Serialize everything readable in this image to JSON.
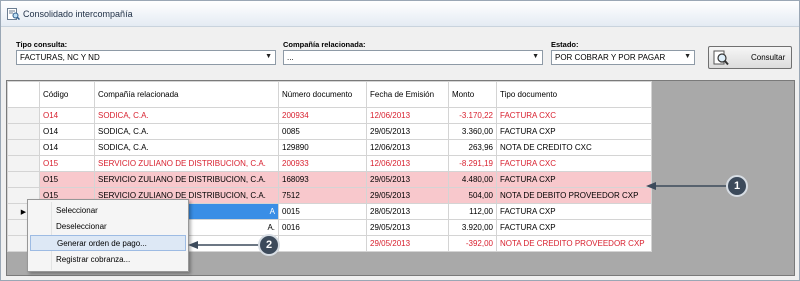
{
  "window": {
    "title": "Consolidado intercompañía"
  },
  "filters": {
    "tipo_label": "Tipo consulta:",
    "tipo_value": "FACTURAS, NC Y ND",
    "compania_label": "Compañía relacionada:",
    "compania_value": "...",
    "estado_label": "Estado:",
    "estado_value": "POR COBRAR Y POR PAGAR",
    "consultar_label": "Consultar"
  },
  "grid": {
    "headers": {
      "codigo": "Código",
      "compania": "Compañía relacionada",
      "numero": "Número documento",
      "fecha": "Fecha de Emisión",
      "monto": "Monto",
      "tipo": "Tipo documento"
    },
    "rows": [
      {
        "codigo": "O14",
        "compania": "SODICA, C.A.",
        "numero": "200934",
        "fecha": "12/06/2013",
        "monto": "-3.170,22",
        "tipo": "FACTURA CXC"
      },
      {
        "codigo": "O14",
        "compania": "SODICA, C.A.",
        "numero": "0085",
        "fecha": "29/05/2013",
        "monto": "3.360,00",
        "tipo": "FACTURA CXP"
      },
      {
        "codigo": "O14",
        "compania": "SODICA, C.A.",
        "numero": "129890",
        "fecha": "12/06/2013",
        "monto": "263,96",
        "tipo": "NOTA DE CREDITO CXC"
      },
      {
        "codigo": "O15",
        "compania": "SERVICIO ZULIANO DE DISTRIBUCION, C.A.",
        "numero": "200933",
        "fecha": "12/06/2013",
        "monto": "-8.291,19",
        "tipo": "FACTURA CXC"
      },
      {
        "codigo": "O15",
        "compania": "SERVICIO ZULIANO DE DISTRIBUCION, C.A.",
        "numero": "168093",
        "fecha": "29/05/2013",
        "monto": "4.480,00",
        "tipo": "FACTURA CXP"
      },
      {
        "codigo": "O15",
        "compania": "SERVICIO ZULIANO DE DISTRIBUCION, C.A.",
        "numero": "7512",
        "fecha": "29/05/2013",
        "monto": "504,00",
        "tipo": "NOTA DE DEBITO PROVEEDOR CXP"
      },
      {
        "codigo": "",
        "compania": "A",
        "numero": "0015",
        "fecha": "28/05/2013",
        "monto": "112,00",
        "tipo": "FACTURA CXP"
      },
      {
        "codigo": "",
        "compania": "A.",
        "numero": "0016",
        "fecha": "29/05/2013",
        "monto": "3.920,00",
        "tipo": "FACTURA CXP"
      },
      {
        "codigo": "",
        "compania": "",
        "numero": "",
        "fecha": "29/05/2013",
        "monto": "-392,00",
        "tipo": "NOTA DE CREDITO PROVEEDOR CXP"
      },
      {
        "codigo": "",
        "compania": "",
        "numero": "",
        "fecha": "",
        "monto": "",
        "tipo": ""
      }
    ]
  },
  "context_menu": {
    "items": [
      "Seleccionar",
      "Deseleccionar",
      "Generar orden de pago...",
      "Registrar cobranza..."
    ]
  },
  "callouts": [
    "1",
    "2"
  ],
  "colors": {
    "red_text": "#d8212f",
    "pink_row": "#f8c8cc",
    "selection": "#3a8ee6",
    "marker": "#3c4a5b"
  }
}
